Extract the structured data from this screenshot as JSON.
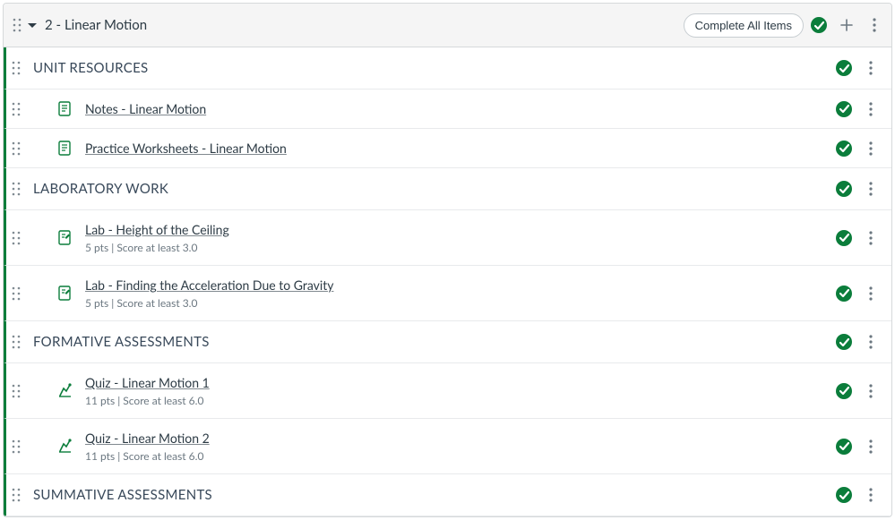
{
  "module": {
    "title": "2 - Linear Motion",
    "complete_all_label": "Complete All Items",
    "sections": [
      {
        "type": "subheader",
        "label": "UNIT RESOURCES"
      },
      {
        "type": "item",
        "icon": "page",
        "title": "Notes - Linear Motion",
        "meta": ""
      },
      {
        "type": "item",
        "icon": "page",
        "title": "Practice Worksheets - Linear Motion",
        "meta": ""
      },
      {
        "type": "subheader",
        "label": "LABORATORY WORK"
      },
      {
        "type": "item",
        "icon": "assignment",
        "title": "Lab - Height of the Ceiling",
        "meta": "5 pts  |  Score at least 3.0"
      },
      {
        "type": "item",
        "icon": "assignment",
        "title": "Lab - Finding the Acceleration Due to Gravity",
        "meta": "5 pts  |  Score at least 3.0"
      },
      {
        "type": "subheader",
        "label": "FORMATIVE ASSESSMENTS"
      },
      {
        "type": "item",
        "icon": "quiz",
        "title": "Quiz - Linear Motion 1",
        "meta": "11 pts  |  Score at least 6.0"
      },
      {
        "type": "item",
        "icon": "quiz",
        "title": "Quiz - Linear Motion 2",
        "meta": "11 pts  |  Score at least 6.0"
      },
      {
        "type": "subheader",
        "label": "SUMMATIVE ASSESSMENTS"
      }
    ]
  }
}
